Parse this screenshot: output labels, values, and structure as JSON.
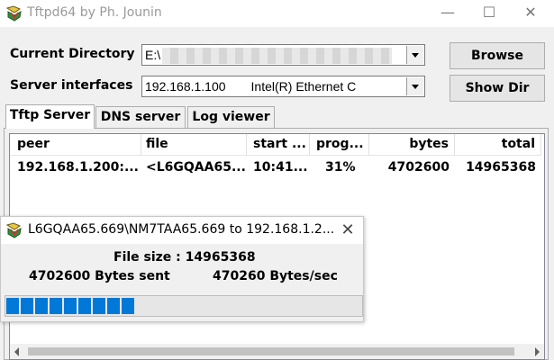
{
  "window": {
    "title": "Tftpd64 by Ph. Jounin",
    "controls": {
      "minimize": "—",
      "maximize": "☐",
      "close": "✕"
    }
  },
  "current_directory": {
    "label": "Current Directory",
    "value": "E:\\"
  },
  "server_interfaces": {
    "label": "Server interfaces",
    "ip": "192.168.1.100",
    "adapter": "Intel(R) Ethernet C"
  },
  "buttons": {
    "browse": "Browse",
    "show_dir": "Show Dir"
  },
  "tabs": [
    {
      "label": "Tftp Server",
      "active": true
    },
    {
      "label": "DNS server",
      "active": false
    },
    {
      "label": "Log viewer",
      "active": false
    }
  ],
  "table": {
    "columns": [
      "peer",
      "file",
      "start ...",
      "prog...",
      "bytes",
      "total"
    ],
    "rows": [
      {
        "peer": "192.168.1.200:...",
        "file": "<L6GQAA65...",
        "start": "10:41...",
        "progress": "31%",
        "bytes": "4702600",
        "total": "14965368"
      }
    ]
  },
  "transfer_dialog": {
    "title": "L6GQAA65.669\\NM7TAA65.669 to 192.168.1.2...",
    "file_size": "File size : 14965368",
    "bytes_sent": "4702600 Bytes sent",
    "rate": "470260 Bytes/sec",
    "progress_fraction": 0.31
  },
  "icons": {
    "app": "tftpd-app-icon",
    "dialog": "tftpd-app-icon"
  },
  "colors": {
    "progress": "#0078d7",
    "background": "#f0f0f0"
  }
}
